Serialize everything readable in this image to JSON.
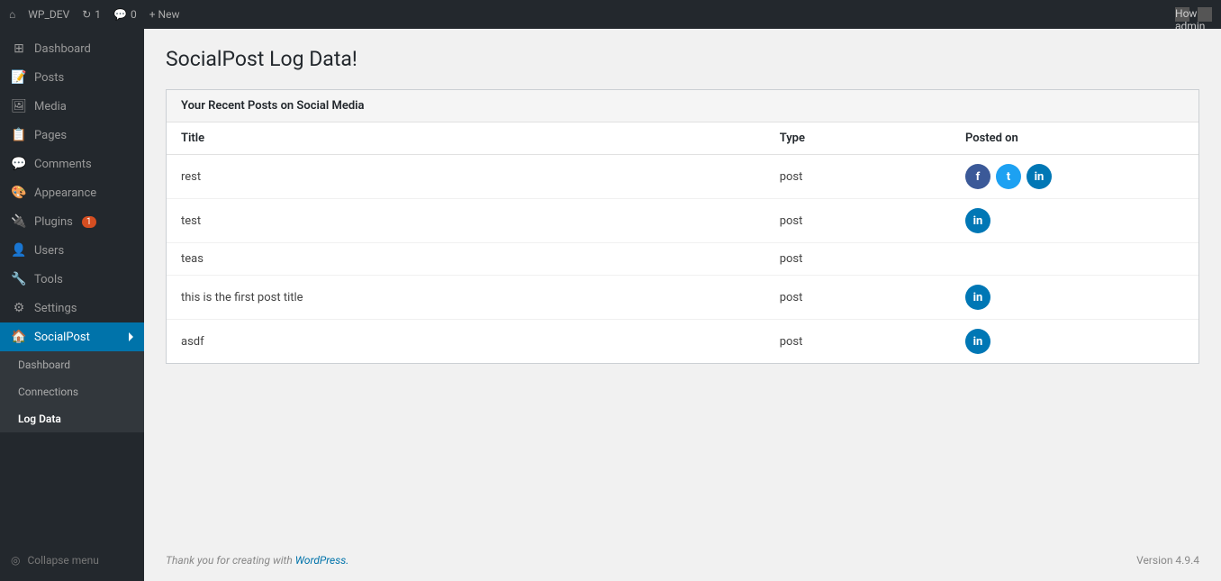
{
  "adminBar": {
    "siteName": "WP_DEV",
    "updates": "1",
    "comments": "0",
    "newLabel": "+ New",
    "howdy": "Howdy, admin"
  },
  "sidebar": {
    "items": [
      {
        "id": "dashboard",
        "label": "Dashboard",
        "icon": "⊞"
      },
      {
        "id": "posts",
        "label": "Posts",
        "icon": "📄"
      },
      {
        "id": "media",
        "label": "Media",
        "icon": "🖼"
      },
      {
        "id": "pages",
        "label": "Pages",
        "icon": "📋"
      },
      {
        "id": "comments",
        "label": "Comments",
        "icon": "💬"
      },
      {
        "id": "appearance",
        "label": "Appearance",
        "icon": "🎨"
      },
      {
        "id": "plugins",
        "label": "Plugins",
        "icon": "🔌",
        "badge": "1"
      },
      {
        "id": "users",
        "label": "Users",
        "icon": "👤"
      },
      {
        "id": "tools",
        "label": "Tools",
        "icon": "🔧"
      },
      {
        "id": "settings",
        "label": "Settings",
        "icon": "⚙"
      }
    ],
    "socialPost": {
      "label": "SocialPost",
      "icon": "🏠",
      "subItems": [
        {
          "id": "sp-dashboard",
          "label": "Dashboard"
        },
        {
          "id": "sp-connections",
          "label": "Connections"
        },
        {
          "id": "sp-logdata",
          "label": "Log Data",
          "active": true
        }
      ]
    },
    "collapseLabel": "Collapse menu"
  },
  "page": {
    "title": "SocialPost Log Data!",
    "cardHeader": "Your Recent Posts on Social Media",
    "table": {
      "columns": [
        "Title",
        "Type",
        "Posted on"
      ],
      "rows": [
        {
          "title": "rest",
          "type": "post",
          "socials": [
            "facebook",
            "twitter",
            "linkedin"
          ]
        },
        {
          "title": "test",
          "type": "post",
          "socials": [
            "linkedin"
          ]
        },
        {
          "title": "teas",
          "type": "post",
          "socials": []
        },
        {
          "title": "this is the first post title",
          "type": "post",
          "socials": [
            "linkedin"
          ]
        },
        {
          "title": "asdf",
          "type": "post",
          "socials": [
            "linkedin"
          ]
        }
      ]
    }
  },
  "footer": {
    "text": "Thank you for creating with ",
    "linkLabel": "WordPress.",
    "version": "Version 4.9.4"
  }
}
